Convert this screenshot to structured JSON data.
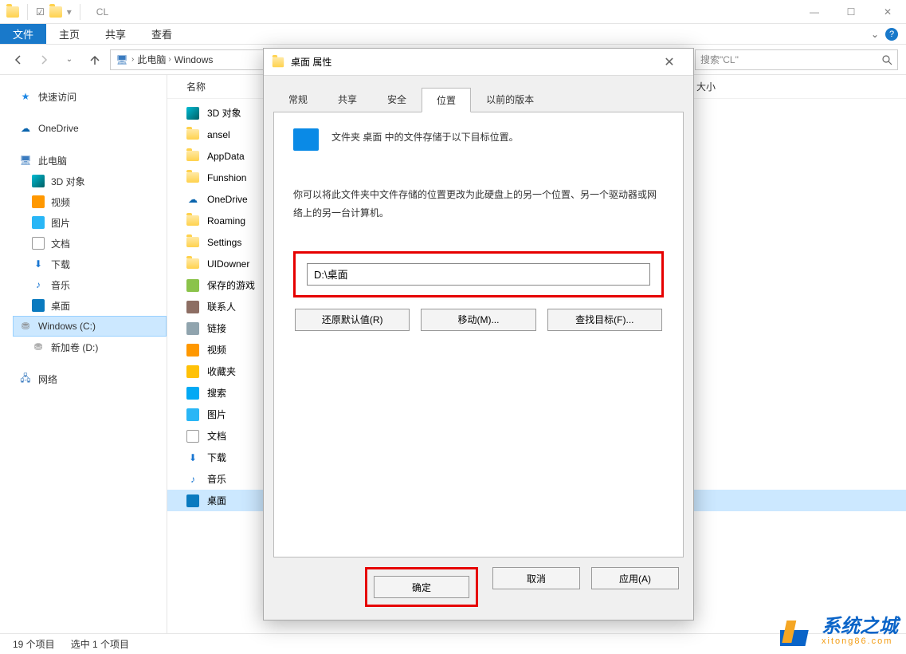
{
  "window": {
    "title": "CL",
    "controls": {
      "min": "—",
      "max": "☐",
      "close": "✕"
    }
  },
  "ribbon": {
    "file": "文件",
    "tabs": [
      "主页",
      "共享",
      "查看"
    ]
  },
  "nav": {
    "back": "←",
    "fwd": "→",
    "up": "↑",
    "refresh": "↻",
    "dropdown": "⌄"
  },
  "address": {
    "segments": [
      "此电脑",
      "Windows"
    ]
  },
  "search": {
    "placeholder": "搜索\"CL\""
  },
  "navpane": {
    "quick": {
      "label": "快速访问"
    },
    "onedrive": {
      "label": "OneDrive"
    },
    "thispc": {
      "label": "此电脑",
      "children": [
        {
          "label": "3D 对象",
          "icon": "3d"
        },
        {
          "label": "视频",
          "icon": "vid"
        },
        {
          "label": "图片",
          "icon": "pic"
        },
        {
          "label": "文档",
          "icon": "doc"
        },
        {
          "label": "下载",
          "icon": "dl"
        },
        {
          "label": "音乐",
          "icon": "mus"
        },
        {
          "label": "桌面",
          "icon": "desk"
        },
        {
          "label": "Windows (C:)",
          "icon": "disk",
          "selected": true
        },
        {
          "label": "新加卷 (D:)",
          "icon": "disk"
        }
      ]
    },
    "network": {
      "label": "网络"
    }
  },
  "columns": {
    "name": "名称",
    "size": "大小"
  },
  "items": [
    {
      "label": "3D 对象",
      "icon": "3d"
    },
    {
      "label": "ansel",
      "icon": "folder"
    },
    {
      "label": "AppData",
      "icon": "folder"
    },
    {
      "label": "Funshion",
      "icon": "folder"
    },
    {
      "label": "OneDrive",
      "icon": "cloud"
    },
    {
      "label": "Roaming",
      "icon": "folder"
    },
    {
      "label": "Settings",
      "icon": "folder"
    },
    {
      "label": "UIDowner",
      "icon": "folder"
    },
    {
      "label": "保存的游戏",
      "icon": "save"
    },
    {
      "label": "联系人",
      "icon": "contact"
    },
    {
      "label": "链接",
      "icon": "link"
    },
    {
      "label": "视频",
      "icon": "vid"
    },
    {
      "label": "收藏夹",
      "icon": "fav"
    },
    {
      "label": "搜索",
      "icon": "search"
    },
    {
      "label": "图片",
      "icon": "pic"
    },
    {
      "label": "文档",
      "icon": "doc"
    },
    {
      "label": "下载",
      "icon": "dl"
    },
    {
      "label": "音乐",
      "icon": "mus"
    },
    {
      "label": "桌面",
      "icon": "desk",
      "selected": true
    }
  ],
  "statusbar": {
    "count": "19 个项目",
    "selected": "选中 1 个项目"
  },
  "dialog": {
    "title": "桌面 属性",
    "tabs": [
      "常规",
      "共享",
      "安全",
      "位置",
      "以前的版本"
    ],
    "active_tab": "位置",
    "line1": "文件夹 桌面 中的文件存储于以下目标位置。",
    "para": "你可以将此文件夹中文件存储的位置更改为此硬盘上的另一个位置、另一个驱动器或网络上的另一台计算机。",
    "path": "D:\\桌面",
    "btn_restore": "还原默认值(R)",
    "btn_move": "移动(M)...",
    "btn_find": "查找目标(F)...",
    "btn_ok": "确定",
    "btn_cancel": "取消",
    "btn_apply": "应用(A)"
  },
  "watermark": {
    "text": "系统之城",
    "sub": "xitong86.com"
  }
}
